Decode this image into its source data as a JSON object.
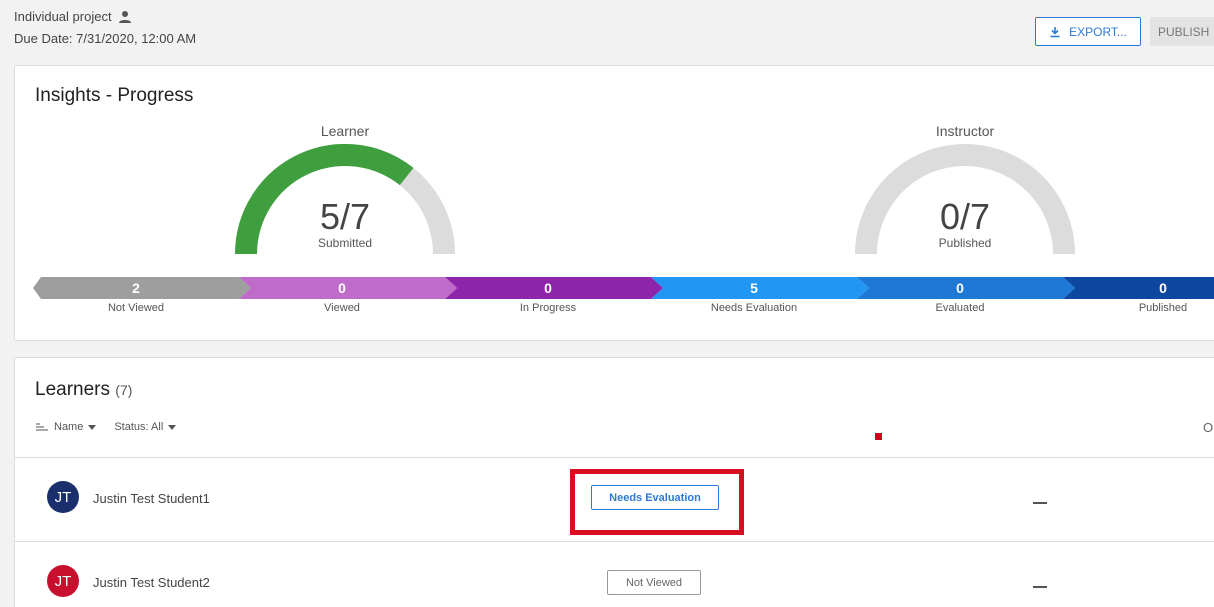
{
  "header": {
    "project_type": "Individual project",
    "due_date": "Due Date: 7/31/2020, 12:00 AM",
    "export_label": "EXPORT...",
    "publish_label": "PUBLISH"
  },
  "insights": {
    "title": "Insights - Progress",
    "learner": {
      "label": "Learner",
      "value": "5/7",
      "sub": "Submitted",
      "fraction": 0.714,
      "color": "#3f9f3f"
    },
    "instructor": {
      "label": "Instructor",
      "value": "0/7",
      "sub": "Published",
      "fraction": 0,
      "color": "#3f9f3f"
    },
    "pipeline": [
      {
        "count": "2",
        "label": "Not Viewed",
        "color": "#9e9e9e"
      },
      {
        "count": "0",
        "label": "Viewed",
        "color": "#bf6bc9"
      },
      {
        "count": "0",
        "label": "In Progress",
        "color": "#8e24aa"
      },
      {
        "count": "5",
        "label": "Needs Evaluation",
        "color": "#2196f3"
      },
      {
        "count": "0",
        "label": "Evaluated",
        "color": "#1e78d6"
      },
      {
        "count": "0",
        "label": "Published",
        "color": "#0d47a1"
      }
    ]
  },
  "learners": {
    "title": "Learners",
    "count": "(7)",
    "sort_label": "Name",
    "status_filter": "Status: All",
    "more": "O",
    "rows": [
      {
        "initials": "JT",
        "name": "Justin Test Student1",
        "status": "Needs Evaluation",
        "avatar_color": "#1a2f6b",
        "score": "—"
      },
      {
        "initials": "JT",
        "name": "Justin Test Student2",
        "status": "Not Viewed",
        "avatar_color": "#c8102e",
        "score": "—"
      }
    ]
  }
}
